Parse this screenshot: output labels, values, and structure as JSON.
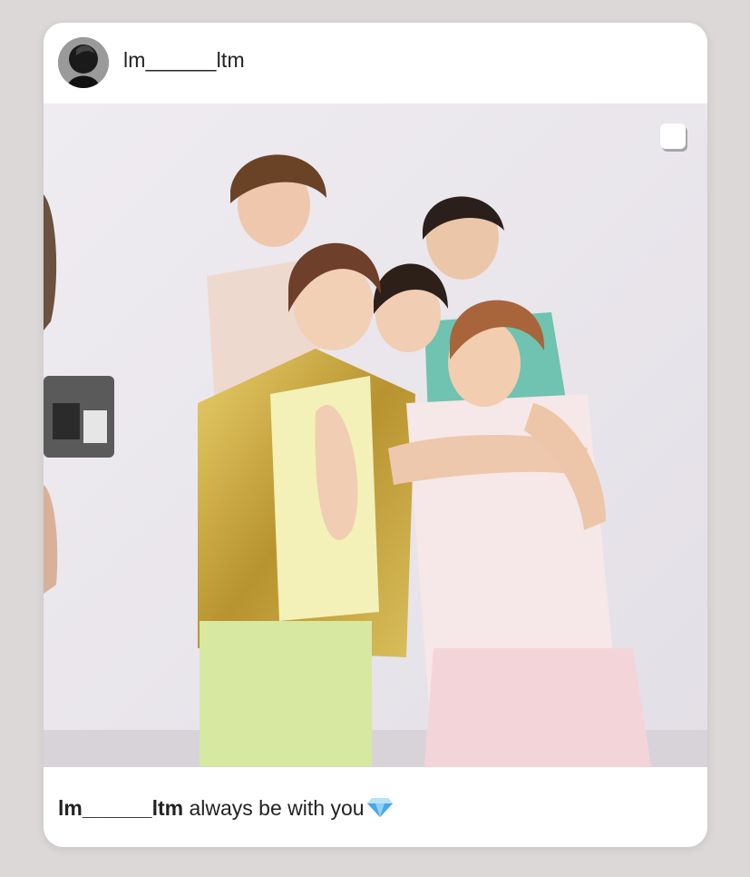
{
  "post": {
    "username": "lm______ltm",
    "caption_user": "lm______ltm",
    "caption_text": "always be with you",
    "caption_emoji": "gem-icon"
  },
  "colors": {
    "background": "#dcd8d8",
    "card": "#ffffff",
    "text": "#222222",
    "photo_wall": "#ece8ee"
  }
}
